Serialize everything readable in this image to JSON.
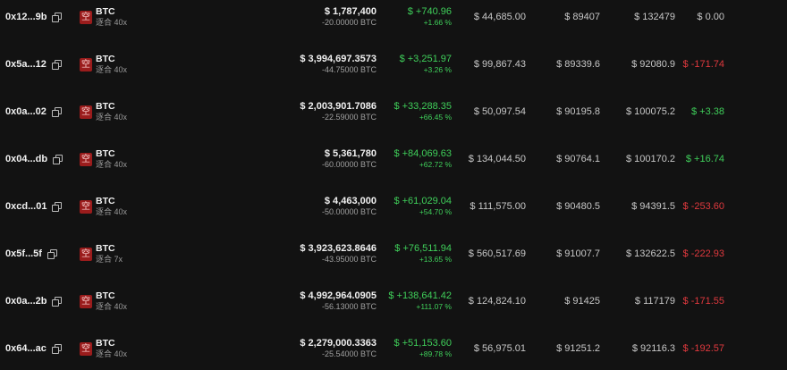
{
  "colors": {
    "positive": "#3fcf5a",
    "negative": "#e0393e",
    "short_badge": "#9a1c1c"
  },
  "icons": {
    "copy": "copy-icon",
    "short": "short-badge-icon"
  },
  "rows": [
    {
      "address": "0x12...9b",
      "badge": "空",
      "symbol": "BTC",
      "leverage": "逐合 40x",
      "position_usd": "$ 1,787,400",
      "position_btc": "-20.00000 BTC",
      "pnl_usd": "$ +740.96",
      "pnl_pct": "+1.66 %",
      "margin": "$ 44,685.00",
      "entry": "$ 89407",
      "liq": "$ 132479",
      "funding": "$ 0.00",
      "funding_sign": "zero"
    },
    {
      "address": "0x5a...12",
      "badge": "空",
      "symbol": "BTC",
      "leverage": "逐合 40x",
      "position_usd": "$ 3,994,697.3573",
      "position_btc": "-44.75000 BTC",
      "pnl_usd": "$ +3,251.97",
      "pnl_pct": "+3.26 %",
      "margin": "$ 99,867.43",
      "entry": "$ 89339.6",
      "liq": "$ 92080.9",
      "funding": "$ -171.74",
      "funding_sign": "neg"
    },
    {
      "address": "0x0a...02",
      "badge": "空",
      "symbol": "BTC",
      "leverage": "逐合 40x",
      "position_usd": "$ 2,003,901.7086",
      "position_btc": "-22.59000 BTC",
      "pnl_usd": "$ +33,288.35",
      "pnl_pct": "+66.45 %",
      "margin": "$ 50,097.54",
      "entry": "$ 90195.8",
      "liq": "$ 100075.2",
      "funding": "$ +3.38",
      "funding_sign": "pos"
    },
    {
      "address": "0x04...db",
      "badge": "空",
      "symbol": "BTC",
      "leverage": "逐合 40x",
      "position_usd": "$ 5,361,780",
      "position_btc": "-60.00000 BTC",
      "pnl_usd": "$ +84,069.63",
      "pnl_pct": "+62.72 %",
      "margin": "$ 134,044.50",
      "entry": "$ 90764.1",
      "liq": "$ 100170.2",
      "funding": "$ +16.74",
      "funding_sign": "pos"
    },
    {
      "address": "0xcd...01",
      "badge": "空",
      "symbol": "BTC",
      "leverage": "逐合 40x",
      "position_usd": "$ 4,463,000",
      "position_btc": "-50.00000 BTC",
      "pnl_usd": "$ +61,029.04",
      "pnl_pct": "+54.70 %",
      "margin": "$ 111,575.00",
      "entry": "$ 90480.5",
      "liq": "$ 94391.5",
      "funding": "$ -253.60",
      "funding_sign": "neg"
    },
    {
      "address": "0x5f...5f",
      "badge": "空",
      "symbol": "BTC",
      "leverage": "逐合 7x",
      "position_usd": "$ 3,923,623.8646",
      "position_btc": "-43.95000 BTC",
      "pnl_usd": "$ +76,511.94",
      "pnl_pct": "+13.65 %",
      "margin": "$ 560,517.69",
      "entry": "$ 91007.7",
      "liq": "$ 132622.5",
      "funding": "$ -222.93",
      "funding_sign": "neg"
    },
    {
      "address": "0x0a...2b",
      "badge": "空",
      "symbol": "BTC",
      "leverage": "逐合 40x",
      "position_usd": "$ 4,992,964.0905",
      "position_btc": "-56.13000 BTC",
      "pnl_usd": "$ +138,641.42",
      "pnl_pct": "+111.07 %",
      "margin": "$ 124,824.10",
      "entry": "$ 91425",
      "liq": "$ 117179",
      "funding": "$ -171.55",
      "funding_sign": "neg"
    },
    {
      "address": "0x64...ac",
      "badge": "空",
      "symbol": "BTC",
      "leverage": "逐合 40x",
      "position_usd": "$ 2,279,000.3363",
      "position_btc": "-25.54000 BTC",
      "pnl_usd": "$ +51,153.60",
      "pnl_pct": "+89.78 %",
      "margin": "$ 56,975.01",
      "entry": "$ 91251.2",
      "liq": "$ 92116.3",
      "funding": "$ -192.57",
      "funding_sign": "neg"
    }
  ]
}
